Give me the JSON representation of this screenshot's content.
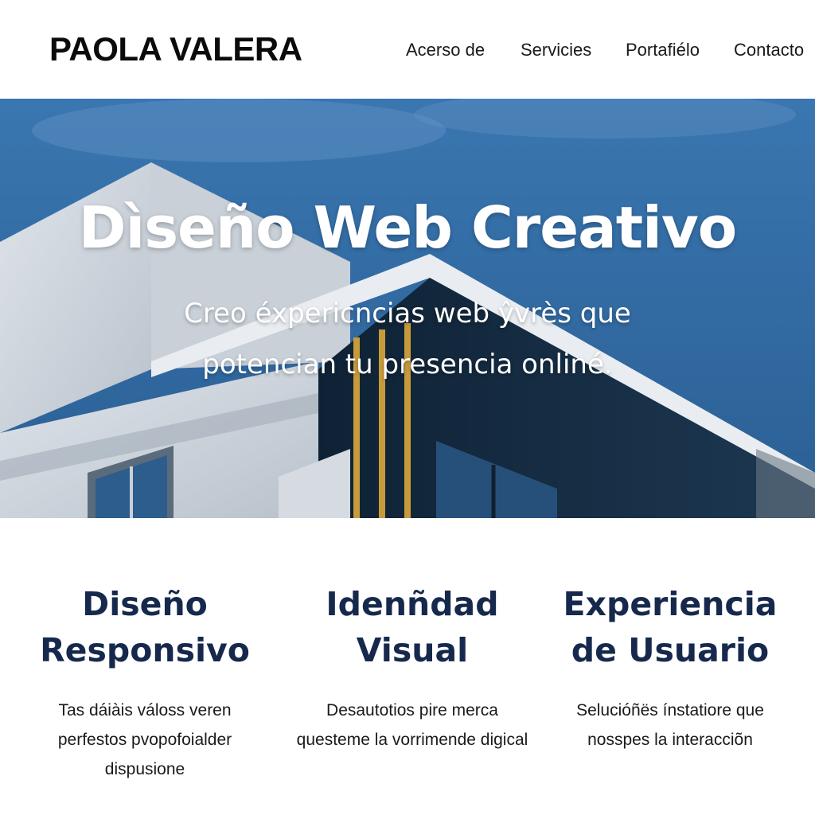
{
  "brand": {
    "name": "PAOLA VALERA"
  },
  "nav": {
    "items": [
      {
        "label": "Acerso de"
      },
      {
        "label": "Servicies"
      },
      {
        "label": "Portafiélo"
      },
      {
        "label": "Contacto"
      }
    ]
  },
  "hero": {
    "title": "Dìseño Web Creativo",
    "subtitle": "Creo éxpericncias web ŷvrès que potencian tu presencia onliné."
  },
  "features": [
    {
      "title": "Diseño Responsivo",
      "text": "Tas dáiàis válos‌s veren perfestos pvopofoialder dispusione"
    },
    {
      "title": "Idenñdad Visual",
      "text": "Desautotios pire merca questeme la vorrimende digical"
    },
    {
      "title": "Experiencia de Usuario",
      "text": "Selucióñës ínstatiore que nosspes la interacciõn"
    }
  ],
  "colors": {
    "heading": "#16294d",
    "sky": "#2b68a2",
    "text": "#1a1a1a",
    "background": "#ffffff"
  }
}
